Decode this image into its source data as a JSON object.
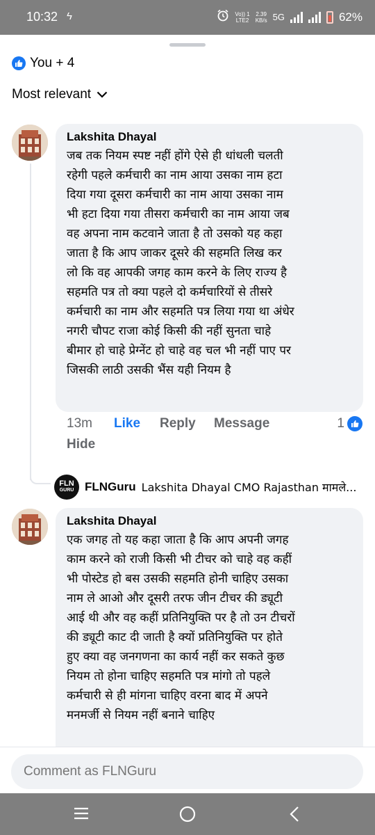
{
  "status_bar": {
    "time": "10:32",
    "net_line1": "Vo)) 1",
    "net_line2": "LTE2",
    "speed_line1": "2.39",
    "speed_line2": "KB/s",
    "network": "5G",
    "battery": "62%"
  },
  "reactions": {
    "summary": "You + 4",
    "icon": "thumbs-up-icon"
  },
  "sort": {
    "label": "Most relevant",
    "icon": "chevron-down-icon"
  },
  "comments": [
    {
      "author": "Lakshita Dhayal",
      "lines": [
        "जब तक नियम स्पष्ट नहीं होंगे ऐसे ही धांधली चलती",
        "रहेगी पहले कर्मचारी का नाम आया उसका नाम हटा",
        "दिया गया दूसरा कर्मचारी का नाम आया उसका नाम",
        "भी हटा दिया गया तीसरा कर्मचारी का नाम आया जब",
        "वह अपना नाम कटवाने जाता है तो उसको यह कहा",
        "जाता है कि आप जाकर दूसरे की सहमति लिख कर",
        "लो कि वह आपकी जगह काम करने के लिए राज्य है",
        "सहमति पत्र तो क्या पहले दो कर्मचारियों से तीसरे",
        "कर्मचारी का नाम और सहमति पत्र लिया गया था अंधेर",
        "नगरी चौपट राजा कोई किसी की नहीं सुनता चाहे",
        "बीमार हो चाहे प्रेग्नेंट हो चाहे वह चल भी नहीं पाए पर",
        "जिसकी लाठी उसकी भैंस यही नियम है"
      ],
      "time": "13m",
      "like_label": "Like",
      "reply_label": "Reply",
      "message_label": "Message",
      "reaction_count": "1",
      "hide_label": "Hide"
    },
    {
      "author": "Lakshita Dhayal",
      "lines": [
        "एक जगह तो यह कहा जाता है कि आप अपनी जगह",
        "काम करने को राजी किसी भी टीचर को चाहे वह कहीं",
        "भी पोस्टेड हो बस उसकी सहमति होनी चाहिए उसका",
        "नाम ले आओ और दूसरी तरफ जीन टीचर की ड्यूटी",
        "आई थी और वह कहीं  प्रतिनियुक्ति पर है तो उन टीचरों",
        "की ड्यूटी काट दी जाती है क्यों प्रतिनियुक्ति पर होते",
        "हुए क्या वह जनगणना का कार्य नहीं कर सकते कुछ",
        "नियम तो होना चाहिए सहमति पत्र मांगो तो पहले",
        "कर्मचारी से ही मांगना चाहिए वरना बाद में अपने",
        "मनमर्जी से नियम नहीं बनाने चाहिए"
      ]
    }
  ],
  "reply_preview": {
    "avatar_text": "FLN",
    "avatar_sub": "GURU",
    "author": "FLNGuru",
    "text": "Lakshita Dhayal CMO Rajasthan मामले..."
  },
  "composer": {
    "placeholder": "Comment as FLNGuru"
  },
  "nav": {
    "recents": "recents-icon",
    "home": "home-icon",
    "back": "back-icon"
  }
}
